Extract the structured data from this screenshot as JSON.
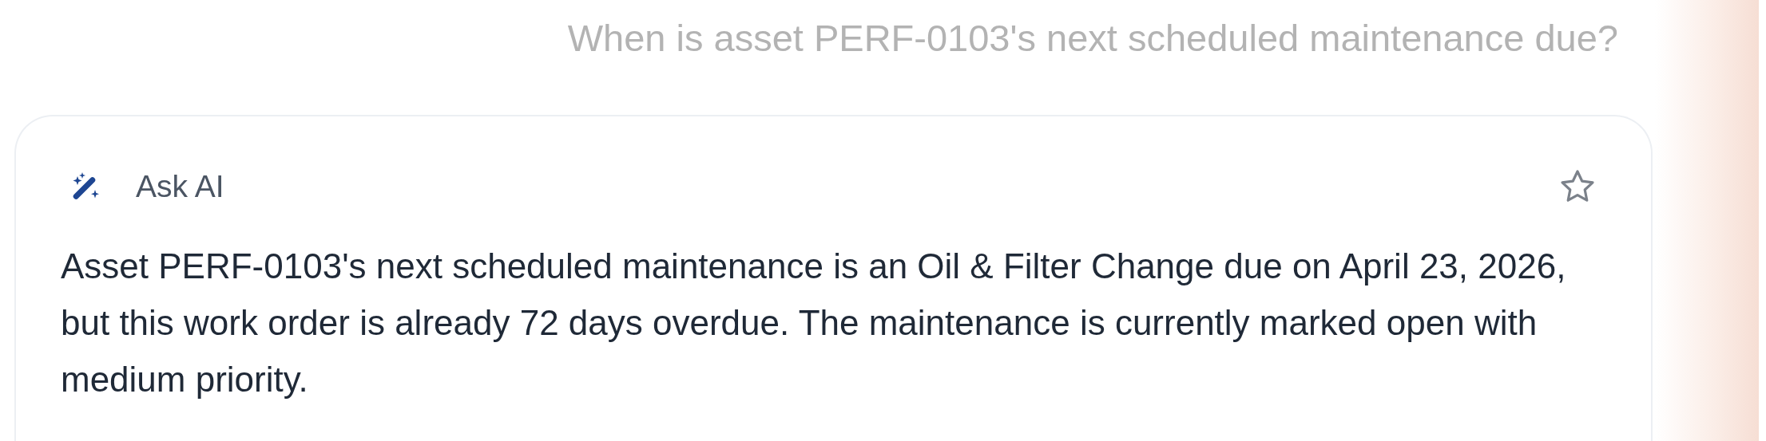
{
  "question": "When is asset PERF-0103's next scheduled maintenance due?",
  "answer_card": {
    "title": "Ask AI",
    "favorited": false,
    "text": "Asset PERF-0103's next scheduled maintenance is an Oil & Filter Change due on April 23, 2026, but this work order is already 72 days overdue. The maintenance is currently marked open with medium priority."
  }
}
